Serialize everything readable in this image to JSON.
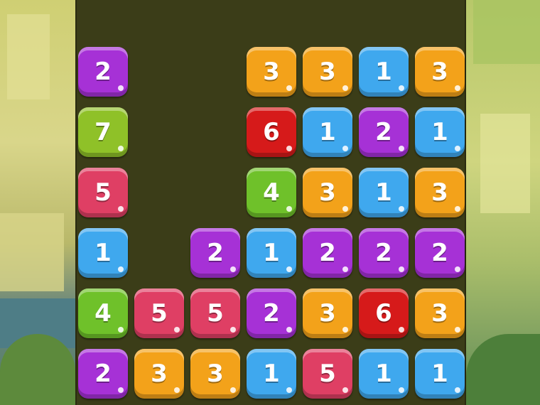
{
  "colors": {
    "purple": "#a631d6",
    "orange": "#f3a21a",
    "blue": "#3fa8ee",
    "red": "#d61a1a",
    "green": "#6fc12a",
    "lime": "#8fc128",
    "pink": "#df3f64",
    "board": "#3b3d18"
  },
  "grid": {
    "columns": 7,
    "rows": [
      [
        {
          "v": "2",
          "c": "purple"
        },
        null,
        null,
        {
          "v": "3",
          "c": "orange"
        },
        {
          "v": "3",
          "c": "orange"
        },
        {
          "v": "1",
          "c": "blue"
        },
        {
          "v": "3",
          "c": "orange"
        }
      ],
      [
        {
          "v": "7",
          "c": "lime"
        },
        null,
        null,
        {
          "v": "6",
          "c": "red"
        },
        {
          "v": "1",
          "c": "blue"
        },
        {
          "v": "2",
          "c": "purple"
        },
        {
          "v": "1",
          "c": "blue"
        }
      ],
      [
        {
          "v": "5",
          "c": "pink"
        },
        null,
        null,
        {
          "v": "4",
          "c": "green"
        },
        {
          "v": "3",
          "c": "orange"
        },
        {
          "v": "1",
          "c": "blue"
        },
        {
          "v": "3",
          "c": "orange"
        }
      ],
      [
        {
          "v": "1",
          "c": "blue"
        },
        null,
        {
          "v": "2",
          "c": "purple"
        },
        {
          "v": "1",
          "c": "blue"
        },
        {
          "v": "2",
          "c": "purple"
        },
        {
          "v": "2",
          "c": "purple"
        },
        {
          "v": "2",
          "c": "purple"
        }
      ],
      [
        {
          "v": "4",
          "c": "green"
        },
        {
          "v": "5",
          "c": "pink"
        },
        {
          "v": "5",
          "c": "pink"
        },
        {
          "v": "2",
          "c": "purple"
        },
        {
          "v": "3",
          "c": "orange"
        },
        {
          "v": "6",
          "c": "red"
        },
        {
          "v": "3",
          "c": "orange"
        }
      ],
      [
        {
          "v": "2",
          "c": "purple"
        },
        {
          "v": "3",
          "c": "orange"
        },
        {
          "v": "3",
          "c": "orange"
        },
        {
          "v": "1",
          "c": "blue"
        },
        {
          "v": "5",
          "c": "pink"
        },
        {
          "v": "1",
          "c": "blue"
        },
        {
          "v": "1",
          "c": "blue"
        }
      ]
    ]
  }
}
